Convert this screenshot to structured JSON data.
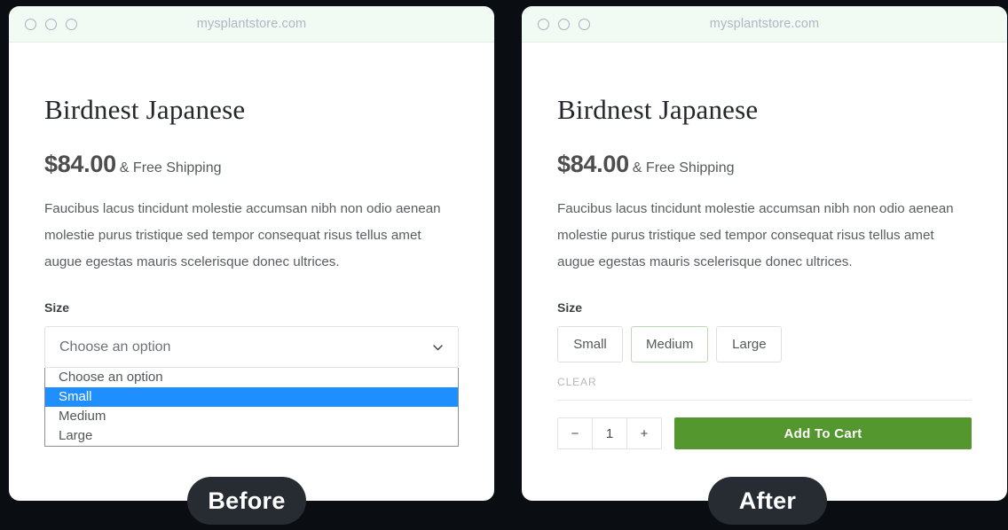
{
  "canvas": {
    "background_color": "#0a0d12"
  },
  "panels": [
    {
      "id": "before",
      "badge_label": "Before",
      "browser": {
        "url": "mysplantstore.com",
        "titlebar_color": "#f2faf4",
        "dots": [
          "window-dot-close",
          "window-dot-minimize",
          "window-dot-maximize"
        ]
      },
      "product": {
        "title": "Birdnest Japanese",
        "price": "$84.00",
        "shipping_note": "& Free Shipping",
        "description": "Faucibus lacus tincidunt molestie accumsan nibh non odio aenean molestie purus tristique sed tempor consequat risus tellus amet augue egestas mauris scelerisque donec ultrices."
      },
      "size_field": {
        "label": "Size",
        "control_type": "select",
        "selected_value": "Choose an option",
        "chevron_icon": "chevron-down-icon",
        "open": true,
        "options": [
          {
            "label": "Choose an option",
            "highlighted": false
          },
          {
            "label": "Small",
            "highlighted": true
          },
          {
            "label": "Medium",
            "highlighted": false
          },
          {
            "label": "Large",
            "highlighted": false
          }
        ],
        "highlight_color": "#1f8fff"
      }
    },
    {
      "id": "after",
      "badge_label": "After",
      "browser": {
        "url": "mysplantstore.com",
        "titlebar_color": "#f2faf4",
        "dots": [
          "window-dot-close",
          "window-dot-minimize",
          "window-dot-maximize"
        ]
      },
      "product": {
        "title": "Birdnest Japanese",
        "price": "$84.00",
        "shipping_note": "& Free Shipping",
        "description": "Faucibus lacus tincidunt molestie accumsan nibh non odio aenean molestie purus tristique sed tempor consequat risus tellus amet augue egestas mauris scelerisque donec ultrices."
      },
      "size_field": {
        "label": "Size",
        "control_type": "swatches",
        "options": [
          {
            "label": "Small",
            "active": false
          },
          {
            "label": "Medium",
            "active": true
          },
          {
            "label": "Large",
            "active": false
          }
        ],
        "active_border_color": "#bed7b4",
        "clear_label": "CLEAR"
      },
      "cart": {
        "decrement_label": "−",
        "quantity_value": "1",
        "increment_label": "+",
        "add_to_cart_label": "Add To Cart",
        "add_to_cart_color": "#54972f"
      }
    }
  ]
}
